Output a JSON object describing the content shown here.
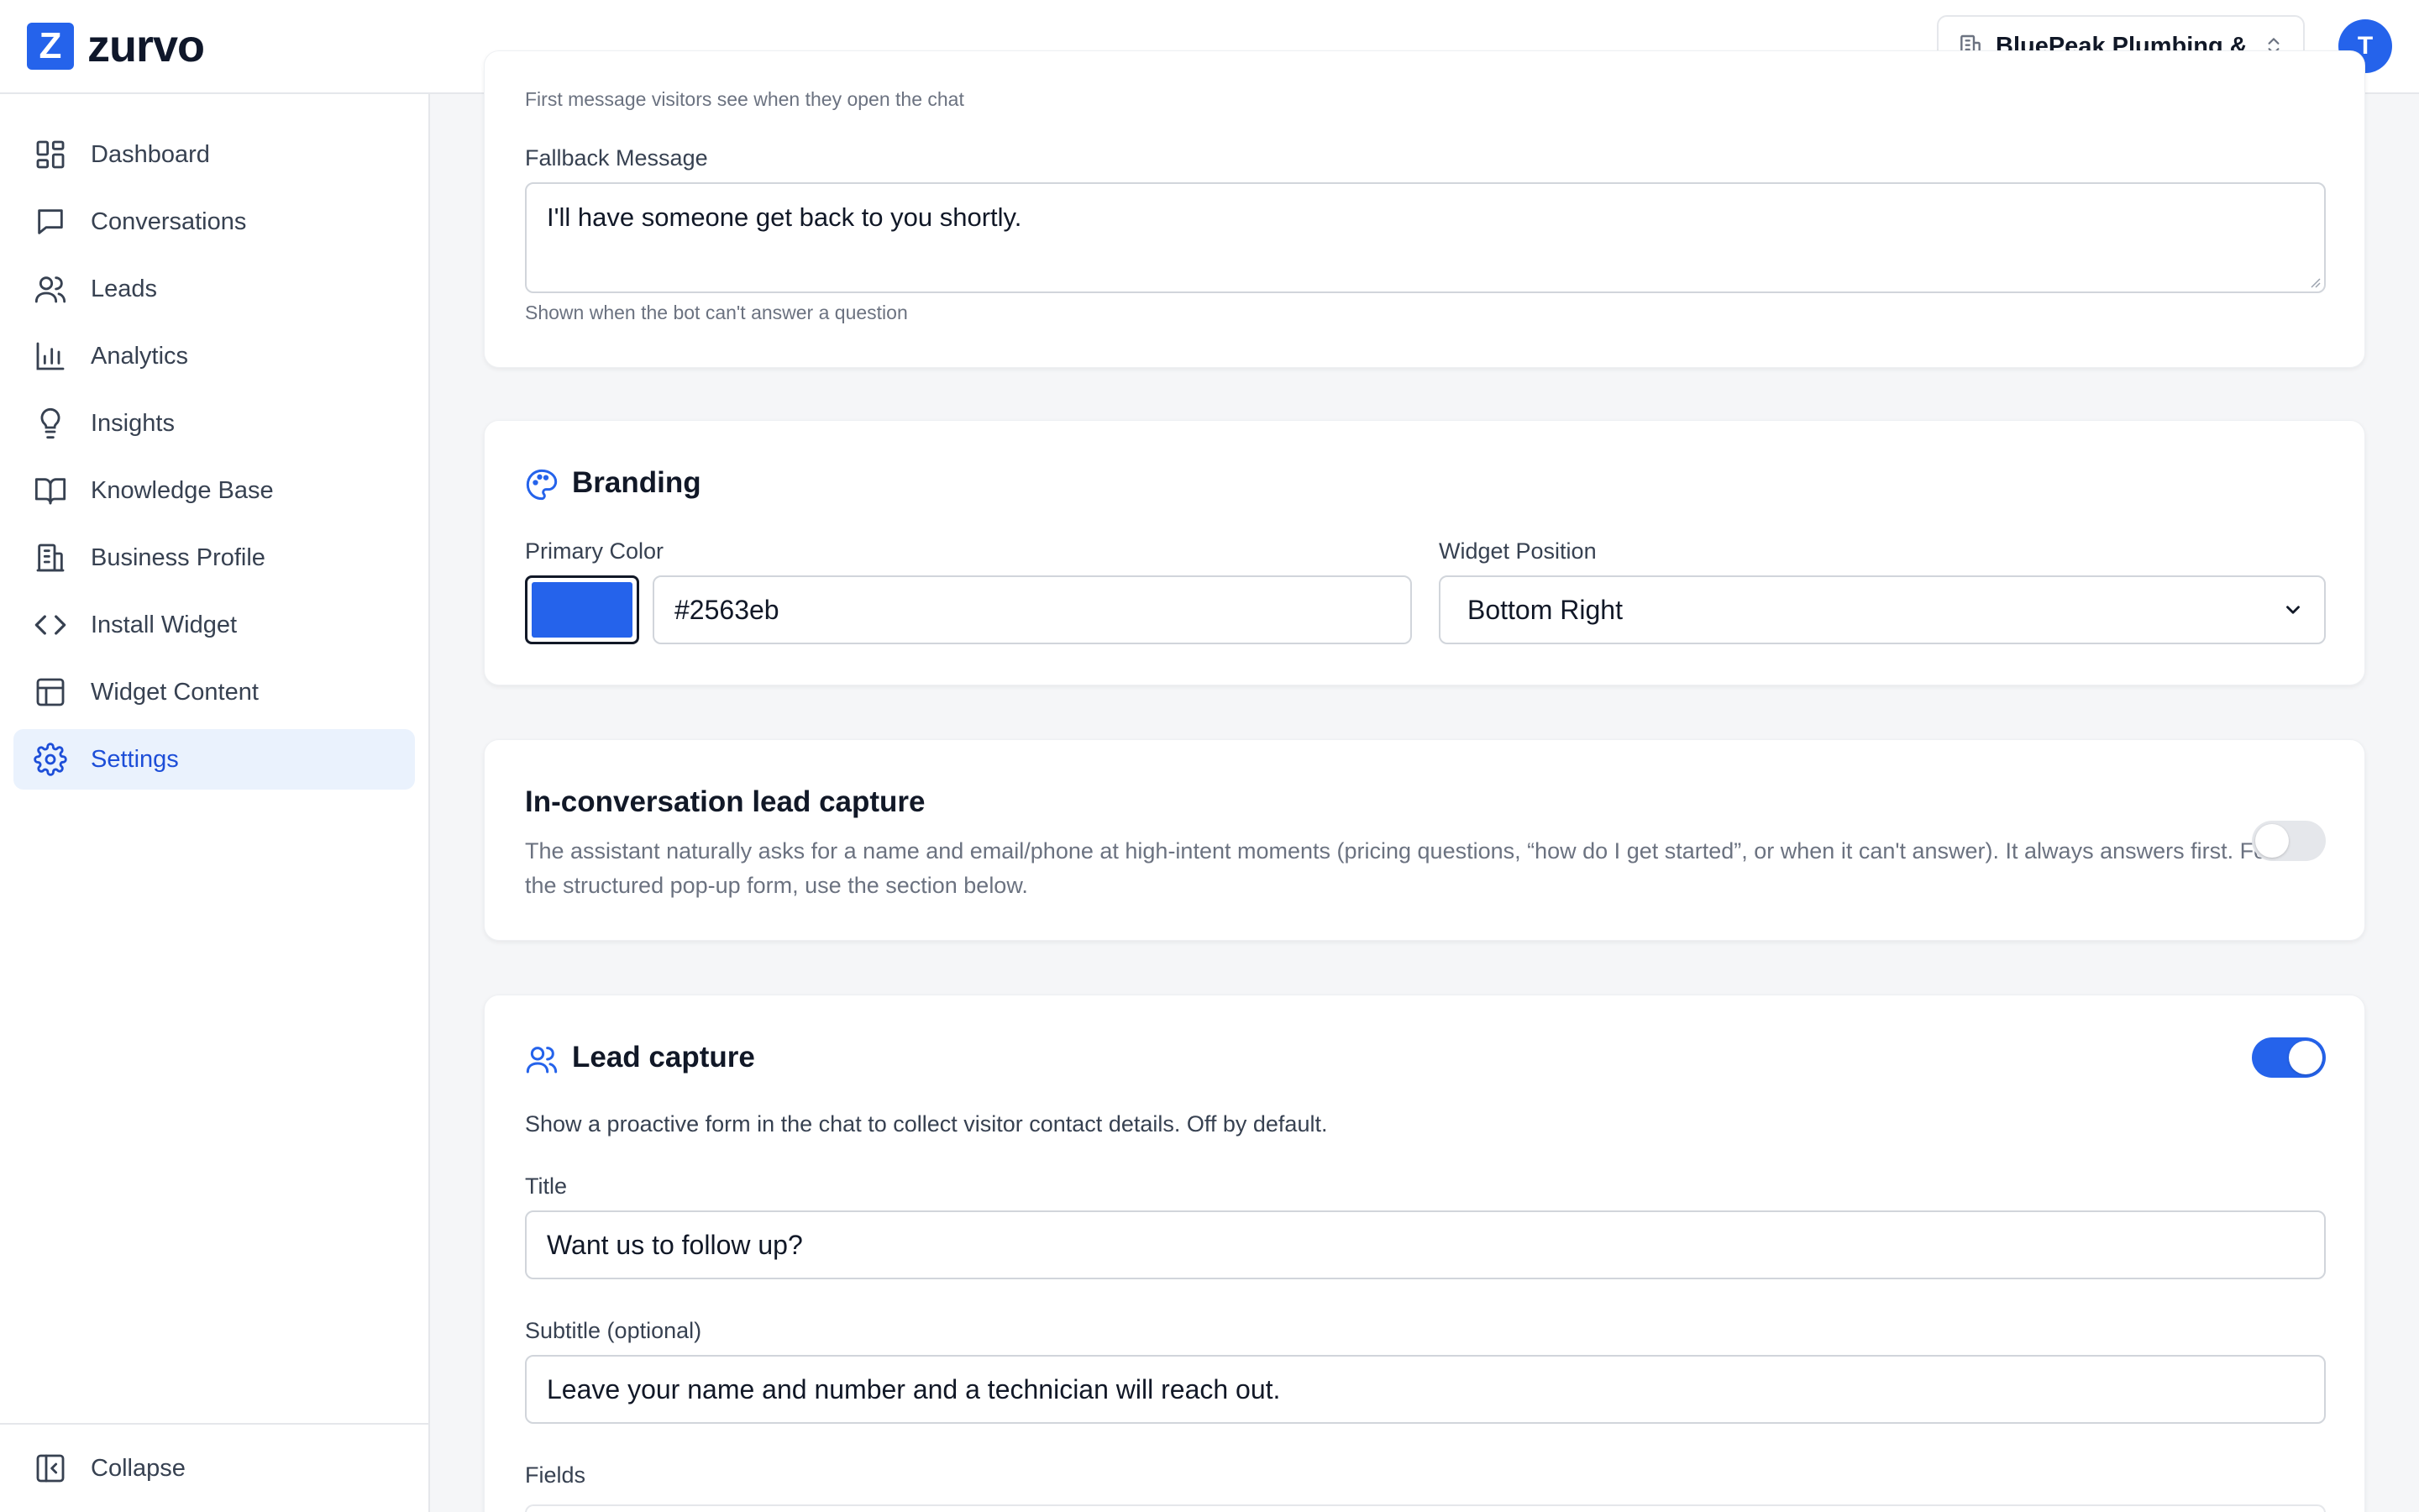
{
  "app": {
    "logo_letter": "Z",
    "logo_text": "zurvo",
    "brand_color": "#2563eb"
  },
  "header": {
    "business_name": "BluePeak Plumbing & ...",
    "avatar_initial": "T"
  },
  "sidebar": {
    "items": [
      {
        "label": "Dashboard",
        "icon": "dashboard-icon"
      },
      {
        "label": "Conversations",
        "icon": "chat-bubble-icon"
      },
      {
        "label": "Leads",
        "icon": "users-icon"
      },
      {
        "label": "Analytics",
        "icon": "bar-chart-icon"
      },
      {
        "label": "Insights",
        "icon": "lightbulb-icon"
      },
      {
        "label": "Knowledge Base",
        "icon": "book-icon"
      },
      {
        "label": "Business Profile",
        "icon": "building-icon"
      },
      {
        "label": "Install Widget",
        "icon": "code-icon"
      },
      {
        "label": "Widget Content",
        "icon": "layout-icon"
      },
      {
        "label": "Settings",
        "icon": "gear-icon",
        "active": true
      }
    ],
    "collapse_label": "Collapse"
  },
  "messages_card": {
    "greeting_help": "First message visitors see when they open the chat",
    "fallback_label": "Fallback Message",
    "fallback_value": "I'll have someone get back to you shortly.",
    "fallback_help": "Shown when the bot can't answer a question"
  },
  "branding": {
    "title": "Branding",
    "primary_color_label": "Primary Color",
    "primary_color_value": "#2563eb",
    "widget_position_label": "Widget Position",
    "widget_position_value": "Bottom Right"
  },
  "inconv_lead_capture": {
    "title": "In-conversation lead capture",
    "description": "The assistant naturally asks for a name and email/phone at high-intent moments (pricing questions, “how do I get started”, or when it can't answer). It always answers first. For the structured pop-up form, use the section below.",
    "enabled": false
  },
  "lead_capture": {
    "title": "Lead capture",
    "enabled": true,
    "description": "Show a proactive form in the chat to collect visitor contact details. Off by default.",
    "title_label": "Title",
    "title_value": "Want us to follow up?",
    "subtitle_label": "Subtitle (optional)",
    "subtitle_value": "Leave your name and number and a technician will reach out.",
    "fields_label": "Fields"
  }
}
